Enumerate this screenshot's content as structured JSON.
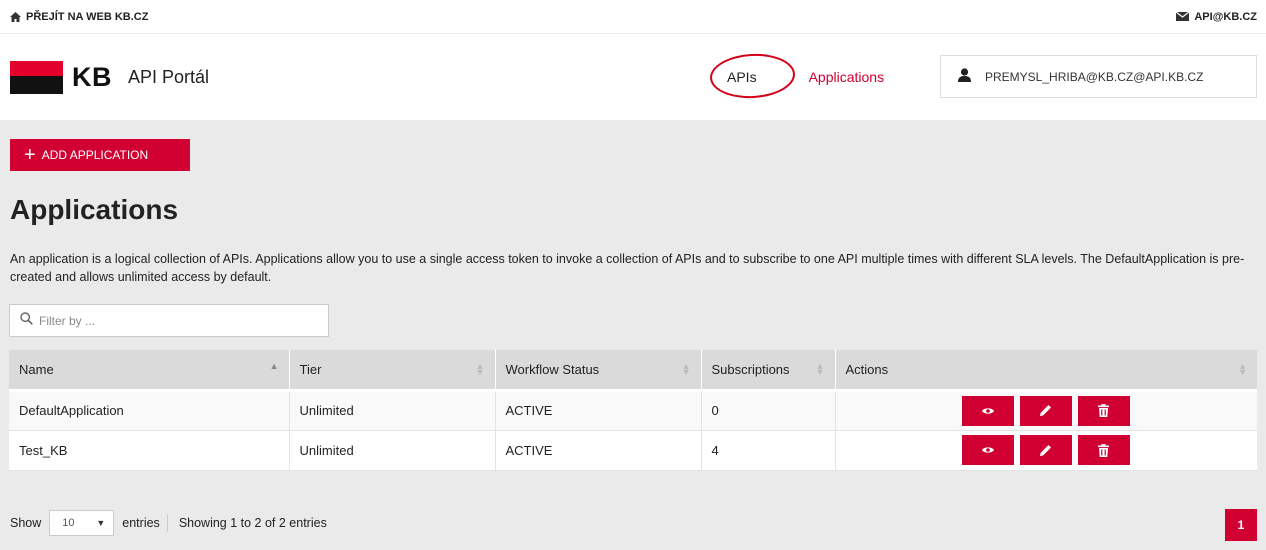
{
  "topbar": {
    "web_link": "PŘEJÍT NA WEB KB.CZ",
    "email_link": "API@KB.CZ"
  },
  "header": {
    "logo_text": "KB",
    "portal_title": "API Portál",
    "nav": {
      "apis": "APIs",
      "applications": "Applications"
    },
    "user": "PREMYSL_HRIBA@KB.CZ@API.KB.CZ"
  },
  "main": {
    "add_button": "ADD APPLICATION",
    "title": "Applications",
    "description": "An application is a logical collection of APIs. Applications allow you to use a single access token to invoke a collection of APIs and to subscribe to one API multiple times with different SLA levels. The DefaultApplication is pre-created and allows unlimited access by default.",
    "filter_placeholder": "Filter by ..."
  },
  "table": {
    "columns": [
      "Name",
      "Tier",
      "Workflow Status",
      "Subscriptions",
      "Actions"
    ],
    "rows": [
      {
        "name": "DefaultApplication",
        "tier": "Unlimited",
        "status": "ACTIVE",
        "subscriptions": "0"
      },
      {
        "name": "Test_KB",
        "tier": "Unlimited",
        "status": "ACTIVE",
        "subscriptions": "4"
      }
    ]
  },
  "footer": {
    "show": "Show",
    "page_length": "10",
    "entries": "entries",
    "info": "Showing 1 to 2 of 2 entries",
    "page": "1"
  },
  "colors": {
    "brand_red": "#d10033",
    "annotation_red": "#d40017"
  },
  "icons": [
    "home-icon",
    "mail-icon",
    "user-icon",
    "search-icon",
    "view-icon",
    "edit-icon",
    "delete-icon",
    "sort-icon",
    "caret-down-icon"
  ]
}
